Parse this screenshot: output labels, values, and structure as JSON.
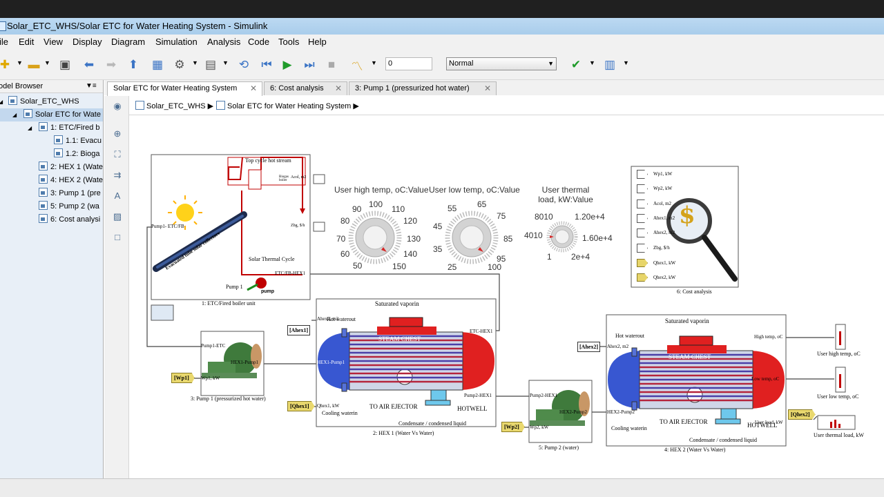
{
  "window": {
    "title": "Solar_ETC_WHS/Solar ETC for Water Heating System - Simulink"
  },
  "menu": [
    "ile",
    "Edit",
    "View",
    "Display",
    "Diagram",
    "Simulation",
    "Analysis",
    "Code",
    "Tools",
    "Help"
  ],
  "toolbar": {
    "stop_time": "0",
    "sim_mode": "Normal"
  },
  "browser": {
    "header": "odel Browser",
    "items": [
      "Solar_ETC_WHS",
      "Solar ETC for Wate",
      "1: ETC/Fired b",
      "1.1: Evacu",
      "1.2: Bioga",
      "2: HEX 1 (Wate",
      "4: HEX 2 (Wate",
      "3: Pump 1 (pre",
      "5: Pump 2 (wa",
      "6: Cost analysi"
    ]
  },
  "tabs": [
    "Solar ETC for Water Heating System",
    "6: Cost analysis",
    "3: Pump 1 (pressurized hot water)"
  ],
  "breadcrumb": [
    "Solar_ETC_WHS",
    "Solar ETC for Water Heating System"
  ],
  "etc_block": {
    "caption": "1: ETC/Fired boiler unit",
    "top_cycle": "Top cycle hot stream",
    "biogas": "Biogas boiler",
    "collector": "Evacuated tube solar collectors",
    "cycle": "Solar Thermal Cycle",
    "pump": "Pump 1",
    "pump_lbl": "pump",
    "port_acol": "Acol, m2",
    "port_zbg": "Zbg, $/h",
    "port_pump": "Pump1- ETC/FB",
    "port_hex": "ETC/FB-HEX1"
  },
  "knob1": {
    "title": "User high temp, oC:Value",
    "ticks": [
      "50",
      "60",
      "70",
      "80",
      "90",
      "100",
      "110",
      "120",
      "130",
      "140",
      "150"
    ]
  },
  "knob2": {
    "title": "User low temp, oC:Value",
    "ticks": [
      "25",
      "35",
      "45",
      "55",
      "65",
      "75",
      "85",
      "95",
      "100"
    ]
  },
  "knob3": {
    "title": "User thermal load, kW:Value",
    "ticks": [
      "1",
      "4010",
      "8010",
      "1.20e+4",
      "1.60e+4",
      "2e+4"
    ]
  },
  "cost": {
    "caption": "6: Cost analysis",
    "ports": [
      "Wp1, kW",
      "Wp2, kW",
      "Acol, m2",
      "Ahex1, m2",
      "Ahex2, m2",
      "Zbg, $/h",
      "Qhex1, kW",
      "Qhex2, kW"
    ]
  },
  "hex1": {
    "caption": "2: HEX 1 (Water Vs Water)",
    "top": "Saturated vaporin",
    "chest": "STEAM CHEST",
    "hot": "Hot waterout",
    "port_ahex": "Ahex1, m2",
    "port_pump": "HEX1-Pump1",
    "port_etc": "ETC-HEX1",
    "port_q": "Qhex1, kW",
    "cool": "Cooling waterin",
    "ejector": "TO AIR EJECTOR",
    "hotwell": "HOTWELL",
    "port_p2": "Pump2-HEX1",
    "cond": "Condensate / condensed liquid"
  },
  "pump1": {
    "caption": "3: Pump 1 (pressurized hot water)",
    "p1": "Pump1-ETC",
    "p2": "HEX1-Pump1",
    "p3": "Wp1, kW"
  },
  "pump2": {
    "caption": "5: Pump 2 (water)",
    "p1": "Pump2-HEX1",
    "p2": "HEX2-Pump2",
    "p3": "Wp2, kW"
  },
  "hex2": {
    "caption": "4: HEX 2 (Water Vs Water)",
    "top": "Saturated vaporin",
    "chest": "STEAM CHEST",
    "hot": "Hot waterout",
    "port_ahex": "Ahex2, m2",
    "port_pump": "HEX2-Pump2",
    "port_high": "High temp, oC",
    "port_low": "Low temp, oC",
    "port_q": "User load, kW",
    "cool": "Cooling waterin",
    "ejector": "TO AIR EJECTOR",
    "hotwell": "HOTWELL",
    "cond": "Condensate / condensed liquid"
  },
  "tags": {
    "ahex1": "[Ahex1]",
    "wp1": "[Wp1]",
    "qhex1": "[Qhex1]",
    "ahex2": "[Ahex2]",
    "wp2": "[Wp2]",
    "qhex2": "[Qhex2]"
  },
  "scopes": {
    "high": "User high temp, oC",
    "low": "User low temp, oC",
    "load": "User thermal load, kW"
  }
}
